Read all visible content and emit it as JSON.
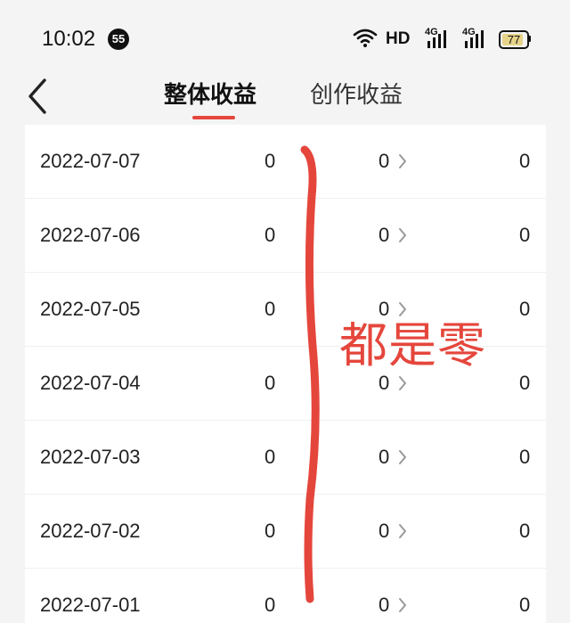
{
  "status_bar": {
    "time": "10:02",
    "notification_count": "55",
    "hd_label": "HD",
    "signal_1_label": "4G",
    "signal_2_label": "4G",
    "battery_percent": "77"
  },
  "nav": {
    "tabs": [
      {
        "label": "整体收益",
        "active": true
      },
      {
        "label": "创作收益",
        "active": false
      }
    ],
    "accent_color": "#e5463c"
  },
  "rows": [
    {
      "date": "2022-07-07",
      "v1": "0",
      "v2": "0",
      "v3": "0"
    },
    {
      "date": "2022-07-06",
      "v1": "0",
      "v2": "0",
      "v3": "0"
    },
    {
      "date": "2022-07-05",
      "v1": "0",
      "v2": "0",
      "v3": "0"
    },
    {
      "date": "2022-07-04",
      "v1": "0",
      "v2": "0",
      "v3": "0"
    },
    {
      "date": "2022-07-03",
      "v1": "0",
      "v2": "0",
      "v3": "0"
    },
    {
      "date": "2022-07-02",
      "v1": "0",
      "v2": "0",
      "v3": "0"
    },
    {
      "date": "2022-07-01",
      "v1": "0",
      "v2": "0",
      "v3": "0"
    }
  ],
  "annotation": {
    "text": "都是零",
    "color": "#e5463c"
  }
}
